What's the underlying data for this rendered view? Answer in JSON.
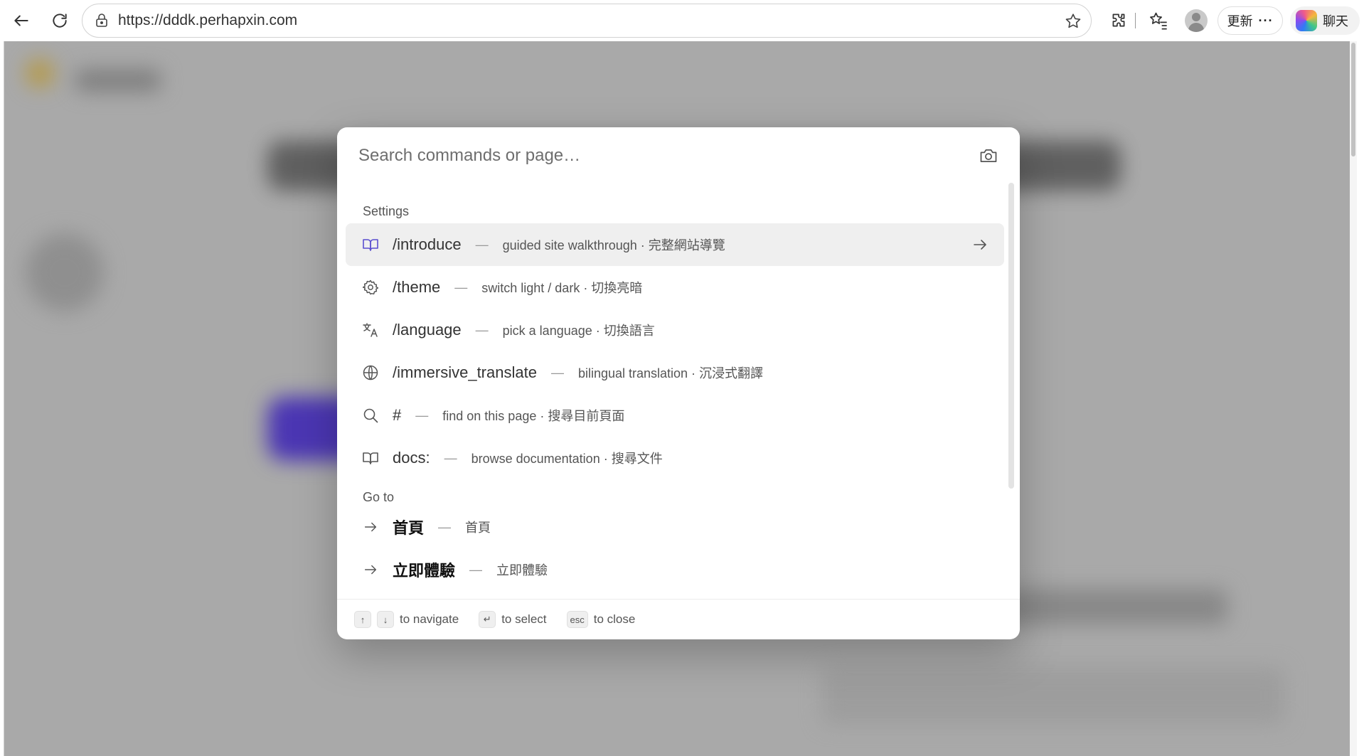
{
  "browser": {
    "url": "https://dddk.perhapxin.com",
    "update_label": "更新",
    "update_dots": "···",
    "chat_label": "聊天"
  },
  "palette": {
    "search_placeholder": "Search commands or page…",
    "groups": [
      {
        "label": "Settings",
        "items": [
          {
            "icon": "book-icon",
            "command": "/introduce",
            "description": "guided site walkthrough · 完整網站導覽",
            "active": true
          },
          {
            "icon": "gear-icon",
            "command": "/theme",
            "description": "switch light / dark · 切換亮暗"
          },
          {
            "icon": "translate-icon",
            "command": "/language",
            "description": "pick a language · 切換語言"
          },
          {
            "icon": "globe-icon",
            "command": "/immersive_translate",
            "description": "bilingual translation · 沉浸式翻譯"
          },
          {
            "icon": "search-icon",
            "command": "#",
            "description": "find on this page · 搜尋目前頁面"
          },
          {
            "icon": "book-icon",
            "command": "docs:",
            "description": "browse documentation · 搜尋文件"
          }
        ]
      },
      {
        "label": "Go to",
        "items": [
          {
            "icon": "arrow-right-icon",
            "command": "首頁",
            "description": "首頁"
          },
          {
            "icon": "arrow-right-icon",
            "command": "立即體驗",
            "description": "立即體驗"
          }
        ]
      }
    ],
    "separator": "—",
    "footer": {
      "up_key": "↑",
      "down_key": "↓",
      "navigate_label": "to navigate",
      "enter_key": "↵",
      "select_label": "to select",
      "esc_key": "esc",
      "close_label": "to close"
    }
  }
}
